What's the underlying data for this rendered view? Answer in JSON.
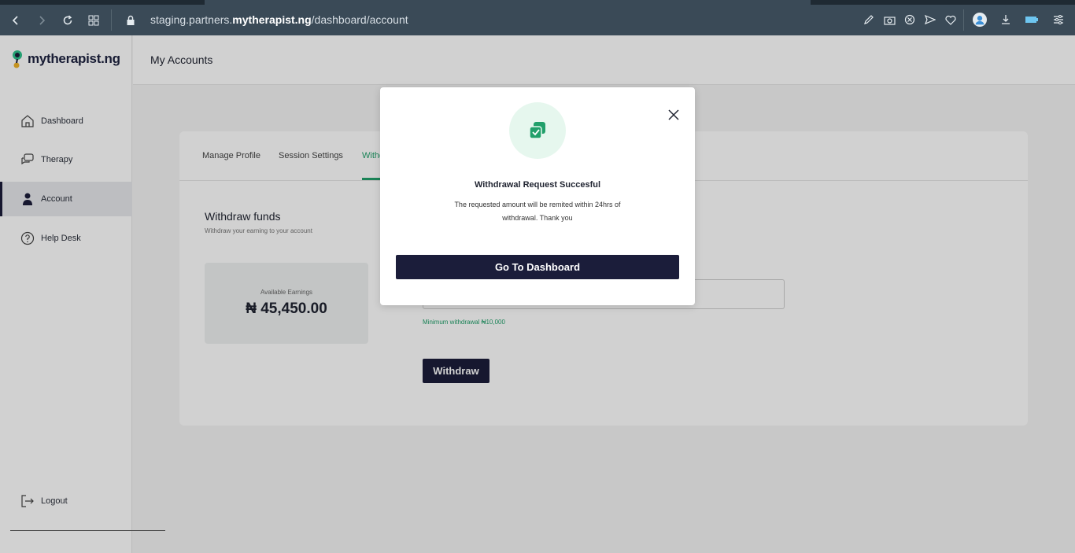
{
  "browser": {
    "url_prefix": "staging.partners.",
    "url_domain": "mytherapist.ng",
    "url_path": "/dashboard/account"
  },
  "sidebar": {
    "logo_text": "mytherapist.ng",
    "items": [
      {
        "label": "Dashboard",
        "icon": "home-icon"
      },
      {
        "label": "Therapy",
        "icon": "chat-icon"
      },
      {
        "label": "Account",
        "icon": "user-icon"
      },
      {
        "label": "Help Desk",
        "icon": "help-icon"
      }
    ],
    "logout_label": "Logout"
  },
  "header": {
    "title": "My Accounts"
  },
  "tabs": [
    "Manage Profile",
    "Session Settings",
    "Withd"
  ],
  "withdraw": {
    "title": "Withdraw funds",
    "subtitle": "Withdraw your earning to your account",
    "earnings_label": "Available Earnings",
    "earnings_value": "₦ 45,450.00",
    "min_note": "Minimum withdrawal ₦10,000",
    "button_label": "Withdraw"
  },
  "modal": {
    "title": "Withdrawal Request Succesful",
    "message": "The requested amount will be remited within 24hrs of withdrawal. Thank you",
    "button_label": "Go To Dashboard"
  },
  "colors": {
    "brand_navy": "#1b1d3a",
    "accent_green": "#22a06b",
    "browser_bar": "#3a4a57"
  }
}
